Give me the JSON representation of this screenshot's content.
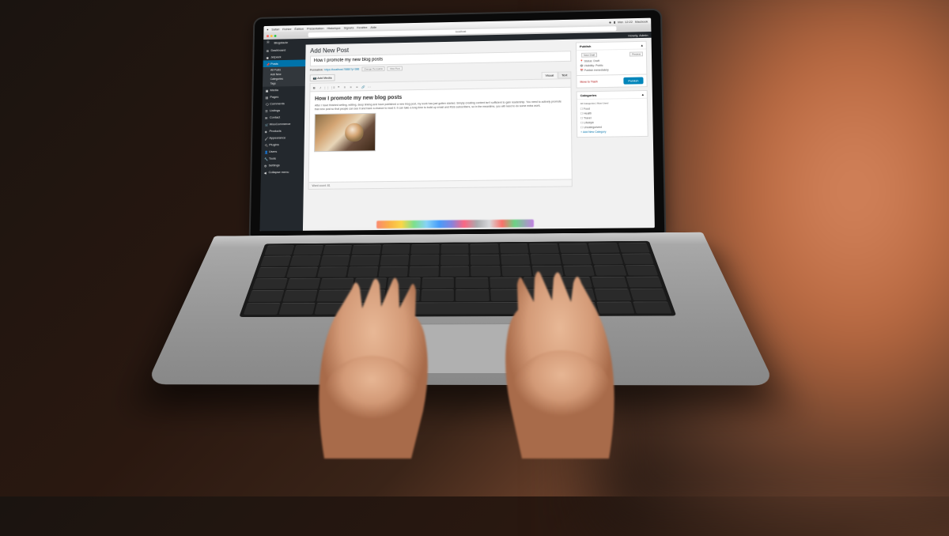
{
  "macos": {
    "app_name": "Safari",
    "menus": [
      "Fichier",
      "Édition",
      "Présentation",
      "Historique",
      "Signets",
      "Fenêtre",
      "Aide"
    ],
    "clock": "Mer. 12:22",
    "user": "Macbook"
  },
  "browser": {
    "url": "localhost"
  },
  "wp_adminbar": {
    "site_name": "Blogstacle",
    "greeting": "Howdy, Admin"
  },
  "sidebar": {
    "items": [
      {
        "label": "Dashboard",
        "icon": "dashboard"
      },
      {
        "label": "Jetpack",
        "icon": "jetpack"
      },
      {
        "label": "Posts",
        "icon": "pin",
        "active": true
      },
      {
        "label": "Media",
        "icon": "media"
      },
      {
        "label": "Pages",
        "icon": "pages"
      },
      {
        "label": "Comments",
        "icon": "comments"
      },
      {
        "label": "Listings",
        "icon": "listings"
      },
      {
        "label": "Contact",
        "icon": "contact"
      },
      {
        "label": "WooCommerce",
        "icon": "woo"
      },
      {
        "label": "Products",
        "icon": "products"
      },
      {
        "label": "Appearance",
        "icon": "appearance"
      },
      {
        "label": "Plugins",
        "icon": "plugins"
      },
      {
        "label": "Users",
        "icon": "users"
      },
      {
        "label": "Tools",
        "icon": "tools"
      },
      {
        "label": "Settings",
        "icon": "settings"
      }
    ],
    "submenu": [
      "All Posts",
      "Add New",
      "Categories",
      "Tags"
    ],
    "collapse": "Collapse menu"
  },
  "page": {
    "heading": "Add New Post",
    "title_value": "How I promote my new blog posts",
    "permalink_label": "Permalink:",
    "permalink_url": "https://localhost:7888/?p=386",
    "permalink_edit": "Change Permalink",
    "view_post": "View Post",
    "add_media": "Add Media",
    "visual_tab": "Visual",
    "text_tab": "Text"
  },
  "editor": {
    "heading": "How I promote my new blog posts",
    "paragraph": "After I have finished writing, editing, deep linking and have published a new blog post, my work has just gotten started. Simply creating content isn't sufficient to gain readership. You need to actively promote that new post so that people can see it and have a chance to read it. It can take a long time to build up email and RSS subscribers, so in the meantime, you will need to do some extra work.",
    "word_count_label": "Word count: 81"
  },
  "publish_box": {
    "title": "Publish",
    "save_draft": "Save Draft",
    "preview": "Preview",
    "status": "Status: Draft",
    "visibility": "Visibility: Public",
    "publish_time": "Publish immediately",
    "trash": "Move to Trash",
    "publish_btn": "Publish"
  },
  "categories_box": {
    "title": "Categories",
    "tabs": [
      "All Categories",
      "Most Used"
    ],
    "items": [
      "Food",
      "Health",
      "Travel",
      "Lifestyle",
      "Uncategorized"
    ],
    "add_new": "+ Add New Category"
  }
}
